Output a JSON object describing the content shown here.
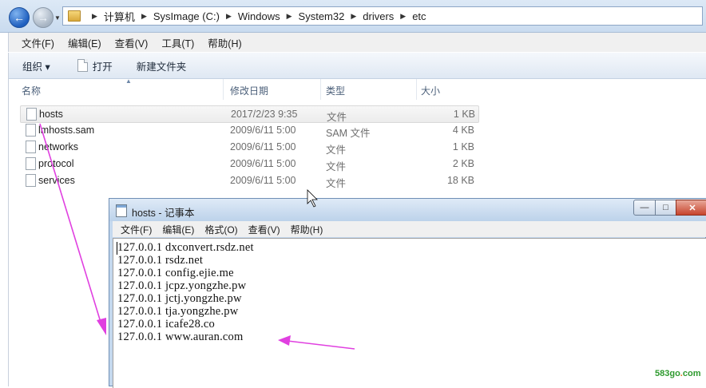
{
  "explorer": {
    "breadcrumbs": [
      "计算机",
      "SysImage (C:)",
      "Windows",
      "System32",
      "drivers",
      "etc"
    ],
    "menu": [
      "文件(F)",
      "编辑(E)",
      "查看(V)",
      "工具(T)",
      "帮助(H)"
    ],
    "toolbar": {
      "organize": "组织 ▾",
      "open": "打开",
      "new_folder": "新建文件夹"
    },
    "columns": {
      "name": "名称",
      "modified": "修改日期",
      "type": "类型",
      "size": "大小"
    },
    "files": [
      {
        "name": "hosts",
        "modified": "2017/2/23 9:35",
        "type": "文件",
        "size": "1 KB",
        "selected": true
      },
      {
        "name": "lmhosts.sam",
        "modified": "2009/6/11 5:00",
        "type": "SAM 文件",
        "size": "4 KB",
        "selected": false
      },
      {
        "name": "networks",
        "modified": "2009/6/11 5:00",
        "type": "文件",
        "size": "1 KB",
        "selected": false
      },
      {
        "name": "protocol",
        "modified": "2009/6/11 5:00",
        "type": "文件",
        "size": "2 KB",
        "selected": false
      },
      {
        "name": "services",
        "modified": "2009/6/11 5:00",
        "type": "文件",
        "size": "18 KB",
        "selected": false
      }
    ]
  },
  "notepad": {
    "title": "hosts - 记事本",
    "menu": [
      "文件(F)",
      "编辑(E)",
      "格式(O)",
      "查看(V)",
      "帮助(H)"
    ],
    "lines": [
      "127.0.0.1 dxconvert.rsdz.net",
      "127.0.0.1 rsdz.net",
      "127.0.0.1 config.ejie.me",
      "127.0.0.1 jcpz.yongzhe.pw",
      "127.0.0.1 jctj.yongzhe.pw",
      "127.0.0.1 tja.yongzhe.pw",
      "127.0.0.1 icafe28.co",
      "127.0.0.1 www.auran.com"
    ]
  },
  "watermark": {
    "prefix": "583go",
    "dot": ".",
    "suffix": "com"
  },
  "colors": {
    "annotation_arrow": "#e040e0",
    "selection": "#ececec",
    "titlebar": "#c4d8ee"
  }
}
